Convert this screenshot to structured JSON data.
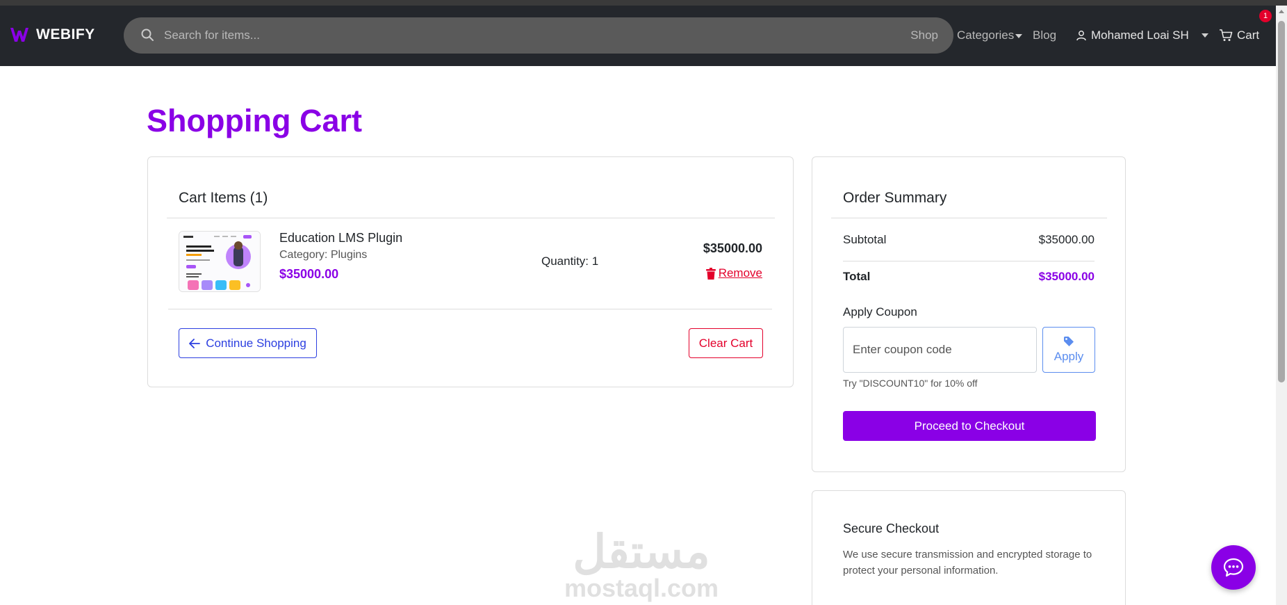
{
  "nav": {
    "brand": "WEBIFY",
    "search_placeholder": "Search for items...",
    "shop": "Shop",
    "categories": "Categories",
    "blog": "Blog",
    "user": "Mohamed Loai SH",
    "cart": "Cart",
    "cart_count": "1"
  },
  "page": {
    "title": "Shopping Cart"
  },
  "cart": {
    "heading": "Cart Items (1)",
    "items": [
      {
        "name": "Education LMS Plugin",
        "category": "Category: Plugins",
        "price": "$35000.00",
        "quantity": "Quantity: 1",
        "line_total": "$35000.00",
        "remove": "Remove"
      }
    ],
    "continue_label": "Continue Shopping",
    "clear_label": "Clear Cart"
  },
  "summary": {
    "heading": "Order Summary",
    "subtotal_label": "Subtotal",
    "subtotal_value": "$35000.00",
    "total_label": "Total",
    "total_value": "$35000.00",
    "coupon_label": "Apply Coupon",
    "coupon_placeholder": "Enter coupon code",
    "apply_label": "Apply",
    "hint": "Try \"DISCOUNT10\" for 10% off",
    "checkout_label": "Proceed to Checkout"
  },
  "secure": {
    "title": "Secure Checkout",
    "text": "We use secure transmission and encrypted storage to protect your personal information."
  },
  "watermark": {
    "arabic": "مستقل",
    "latin": "mostaql.com"
  },
  "colors": {
    "accent": "#8a00e6",
    "danger": "#e3002b",
    "link_blue": "#2c3fe0",
    "navbar": "#24272c"
  },
  "icons": {
    "logo": "webify-logo-icon",
    "search": "search-icon",
    "user": "user-icon",
    "cart": "cart-icon",
    "trash": "trash-icon",
    "arrow_left": "arrow-left-icon",
    "tag": "tag-icon",
    "chat": "chat-icon"
  }
}
